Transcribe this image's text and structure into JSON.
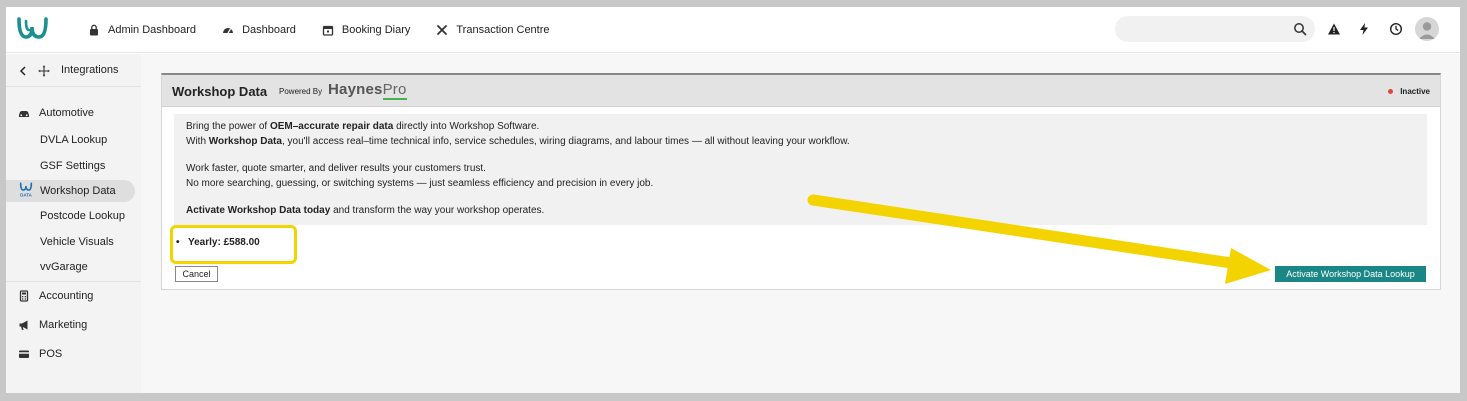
{
  "nav": {
    "items": [
      {
        "label": "Admin Dashboard",
        "icon": "lock-icon"
      },
      {
        "label": "Dashboard",
        "icon": "dashboard-icon"
      },
      {
        "label": "Booking Diary",
        "icon": "calendar-icon"
      },
      {
        "label": "Transaction Centre",
        "icon": "tools-icon"
      }
    ],
    "search_placeholder": ""
  },
  "sidebar": {
    "back_label": "Integrations",
    "sections": [
      {
        "label": "Automotive",
        "icon": "car-icon"
      },
      {
        "label": "Accounting",
        "icon": "calculator-icon"
      },
      {
        "label": "Marketing",
        "icon": "megaphone-icon"
      },
      {
        "label": "POS",
        "icon": "card-icon"
      }
    ],
    "subitems": [
      {
        "label": "DVLA Lookup"
      },
      {
        "label": "GSF Settings"
      },
      {
        "label": "Workshop Data",
        "active": true
      },
      {
        "label": "Postcode Lookup"
      },
      {
        "label": "Vehicle Visuals"
      },
      {
        "label": "vvGarage"
      }
    ],
    "active_badge_text": "DATA"
  },
  "panel": {
    "title": "Workshop Data",
    "powered_by": "Powered By",
    "brand_main": "Haynes",
    "brand_pro": "Pro",
    "status": "Inactive",
    "desc": {
      "l1_pre": "Bring the power of ",
      "l1_bold": "OEM–accurate repair data",
      "l1_post": " directly into Workshop Software.",
      "l2_pre": "With ",
      "l2_bold": "Workshop Data",
      "l2_post": ", you'll access real–time technical info, service schedules, wiring diagrams, and labour times — all without leaving your workflow.",
      "l3": "Work faster, quote smarter, and deliver results your customers trust.",
      "l4": "No more searching, guessing, or switching systems — just seamless efficiency and precision in every job.",
      "l5_bold": "Activate Workshop Data today",
      "l5_post": " and transform the way your workshop operates."
    },
    "price": "Yearly: £588.00",
    "cancel_label": "Cancel",
    "activate_label": "Activate Workshop Data Lookup"
  },
  "colors": {
    "accent_teal": "#1a8686",
    "highlight_yellow": "#f3d400",
    "status_red": "#e0453a"
  }
}
